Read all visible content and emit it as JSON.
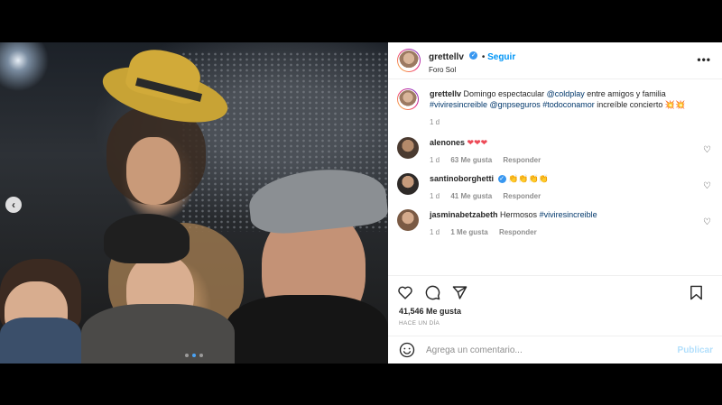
{
  "post": {
    "username": "grettellv",
    "follow_label": "Seguir",
    "location": "Foro Sol",
    "more_label": "•••"
  },
  "caption": {
    "username": "grettellv",
    "text_before": "Domingo espectacular ",
    "mention1": "@coldplay",
    "text_mid": " entre amigos y familia ",
    "hashtag1": "#viviresincreible",
    "mention2": "@gnpseguros",
    "hashtag2": "#todoconamor",
    "text_after": " increíble concierto 💥💥",
    "time": "1 d"
  },
  "comments": [
    {
      "username": "alenones",
      "text": "❤❤❤",
      "time": "1 d",
      "likes": "63 Me gusta",
      "reply": "Responder",
      "verified": false
    },
    {
      "username": "santinoborghetti",
      "text": "👏👏👏👏",
      "time": "1 d",
      "likes": "41 Me gusta",
      "reply": "Responder",
      "verified": true
    },
    {
      "username": "jasminabetzabeth",
      "text": "Hermosos ",
      "hashtag": "#viviresincreible",
      "time": "1 d",
      "likes": "1 Me gusta",
      "reply": "Responder",
      "verified": false
    }
  ],
  "likes_text": "41,546 Me gusta",
  "time_ago": "HACE UN DÍA",
  "add_comment": {
    "placeholder": "Agrega un comentario...",
    "publish_label": "Publicar"
  },
  "carousel": {
    "active_index": 1,
    "count": 3
  },
  "colors": {
    "accent": "#0095f6",
    "tag": "#00376b",
    "heart_red": "#ed4956"
  },
  "icons": [
    "chevron-left-icon",
    "heart-icon",
    "comment-icon",
    "share-icon",
    "bookmark-icon",
    "emoji-icon",
    "verified-icon",
    "more-icon"
  ]
}
